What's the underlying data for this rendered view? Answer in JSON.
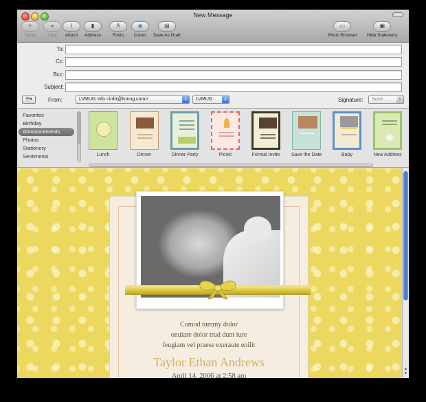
{
  "window": {
    "title": "New Message"
  },
  "toolbar": {
    "send": "Send",
    "chat": "Chat",
    "attach": "Attach",
    "address": "Address",
    "fonts": "Fonts",
    "colors": "Colors",
    "save_draft": "Save As Draft",
    "photo_browser": "Photo Browser",
    "hide_stationery": "Hide Stationery"
  },
  "headers": {
    "to_label": "To:",
    "cc_label": "Cc:",
    "bcc_label": "Bcc:",
    "subject_label": "Subject:",
    "to_value": "",
    "cc_value": "",
    "bcc_value": "",
    "subject_value": "",
    "from_label": "From:",
    "from_value": "LVMUG Info <info@lvmug.com>",
    "account_value": "LVMUG",
    "signature_label": "Signature:",
    "signature_value": "None"
  },
  "stationery": {
    "categories": [
      "Favorites",
      "Birthday",
      "Announcements",
      "Photos",
      "Stationery",
      "Sentiments"
    ],
    "selected_category": "Announcements",
    "templates": [
      "Lunch",
      "Dinner",
      "Dinner Party",
      "Picnic",
      "Formal Invite",
      "Save the Date",
      "Baby",
      "New Address"
    ]
  },
  "invite": {
    "line1": "Comod tummy dolor",
    "line2": "onulare dolor trud dunt iure",
    "line3": "feugiam vel praese exeraute enilit",
    "name": "Taylor Ethan Andrews",
    "date": "April 14, 2006 at 2:58 am"
  },
  "colors": {
    "body_background": "#ecd85f",
    "name_text": "#d4ab63",
    "scrollbar": "#3b73cc"
  }
}
